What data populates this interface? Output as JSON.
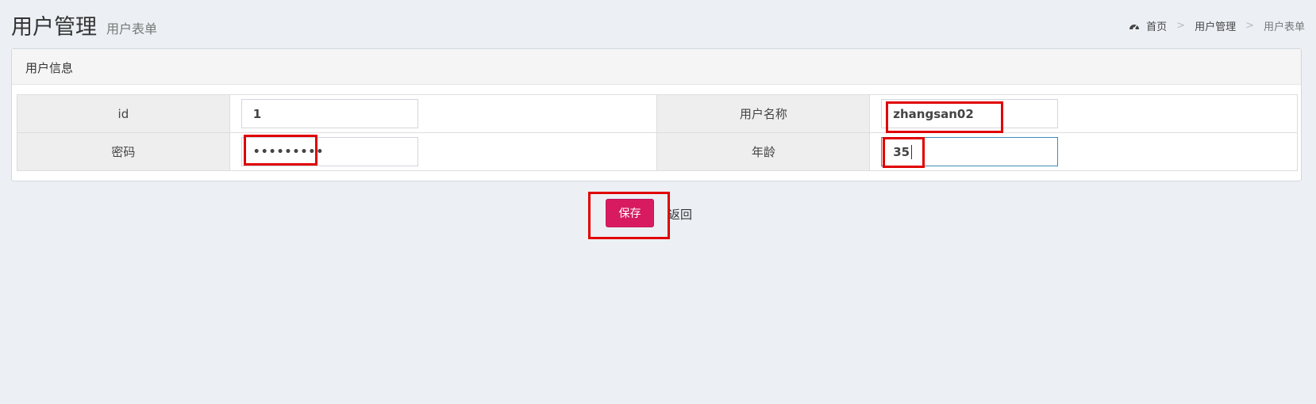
{
  "header": {
    "title": "用户管理",
    "subtitle": "用户表单"
  },
  "breadcrumb": {
    "icon": "dashboard-icon",
    "items": [
      "首页",
      "用户管理",
      "用户表单"
    ],
    "separator": ">"
  },
  "box": {
    "title": "用户信息"
  },
  "form": {
    "id_label": "id",
    "id_value": "1",
    "username_label": "用户名称",
    "username_value": "zhangsan02",
    "password_label": "密码",
    "password_value": "•••••••••",
    "age_label": "年龄",
    "age_value": "35"
  },
  "actions": {
    "save_label": "保存",
    "back_label": "返回"
  },
  "colors": {
    "background": "#ecf0f5",
    "save_button": "#d81b60",
    "highlight": "#e00000",
    "focus_border": "#3c8dbc"
  }
}
